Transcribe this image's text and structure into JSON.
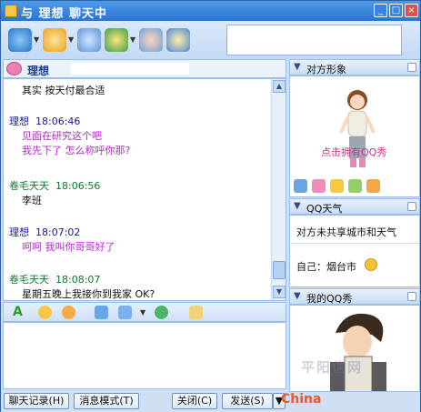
{
  "window": {
    "title": "与 理想 聊天中",
    "minimize_glyph": "_",
    "maximize_glyph": "□",
    "close_glyph": "×"
  },
  "toolbar": {
    "icons": [
      "video-call-icon",
      "send-file-icon",
      "application-icon",
      "game-icon",
      "add-contact-icon",
      "settings-icon"
    ]
  },
  "chat": {
    "contact_name": "理想",
    "messages": [
      {
        "sender": "",
        "time": "",
        "text": "其实 按天付最合适",
        "sender_color": "#1a1a8c",
        "text_color": "#111111"
      },
      {
        "sender": "理想",
        "time": "18:06:46",
        "text": "见面在研究这个吧",
        "sender_color": "#1a1a8c",
        "text_color": "#b02ec4"
      },
      {
        "sender": "",
        "time": "",
        "text": "我先下了  怎么称呼你那?",
        "sender_color": "#1a1a8c",
        "text_color": "#b02ec4"
      },
      {
        "sender": "卷毛天天",
        "time": "18:06:56",
        "text": "李班",
        "sender_color": "#0c7a2a",
        "text_color": "#111111"
      },
      {
        "sender": "理想",
        "time": "18:07:02",
        "text": "呵呵  我叫你哥哥好了",
        "sender_color": "#1a1a8c",
        "text_color": "#b02ec4"
      },
      {
        "sender": "卷毛天天",
        "time": "18:08:07",
        "text": "星期五晚上我接你到我家 OK?",
        "sender_color": "#0c7a2a",
        "text_color": "#111111"
      }
    ]
  },
  "format_bar": {
    "icons": [
      "font-icon",
      "emoticon-icon",
      "magic-face-icon",
      "screenshot-icon",
      "image-icon",
      "chevron-down-icon",
      "voice-message-icon",
      "message-history-icon"
    ]
  },
  "buttons": {
    "history": "聊天记录(H)",
    "message_mode": "消息模式(T)",
    "close": "关闭(C)",
    "send": "发送(S)"
  },
  "sidebar": {
    "avatar_section": {
      "label": "对方形象",
      "show_link": "点击拥有QQ秀"
    },
    "weather_section": {
      "label": "QQ天气",
      "notice": "对方未共享城市和天气",
      "my_city": "自己：烟台市"
    },
    "qqshow_section": {
      "label": "我的QQ秀"
    }
  },
  "watermark": {
    "text": "平阳信网",
    "site": "China"
  },
  "colors": {
    "titlebar": "#2b74d1",
    "accent": "#1a3e8a",
    "link": "#d1318b"
  }
}
